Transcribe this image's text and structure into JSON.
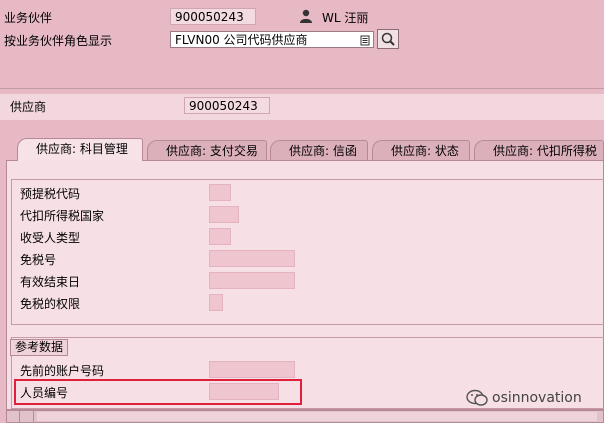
{
  "header": {
    "partner_label": "业务伙伴",
    "partner_value": "900050243",
    "user_name": "WL 汪丽",
    "role_label": "按业务伙伴角色显示",
    "role_value": "FLVN00 公司代码供应商"
  },
  "vendor": {
    "label": "供应商",
    "value": "900050243"
  },
  "tabs": [
    {
      "label": "供应商: 科目管理"
    },
    {
      "label": "供应商: 支付交易"
    },
    {
      "label": "供应商: 信函"
    },
    {
      "label": "供应商: 状态"
    },
    {
      "label": "供应商: 代扣所得税"
    }
  ],
  "tax_fields": [
    {
      "label": "预提税代码"
    },
    {
      "label": "代扣所得税国家"
    },
    {
      "label": "收受人类型"
    },
    {
      "label": "免税号"
    },
    {
      "label": "有效结束日"
    },
    {
      "label": "免税的权限"
    }
  ],
  "reference": {
    "title": "参考数据",
    "fields": [
      {
        "label": "先前的账户号码"
      },
      {
        "label": "人员编号"
      }
    ]
  },
  "watermark": {
    "text": "osinnovation"
  },
  "colors": {
    "background": "#e6b9c4",
    "panel": "#f6dfe5",
    "highlight_border": "#e0203a"
  }
}
